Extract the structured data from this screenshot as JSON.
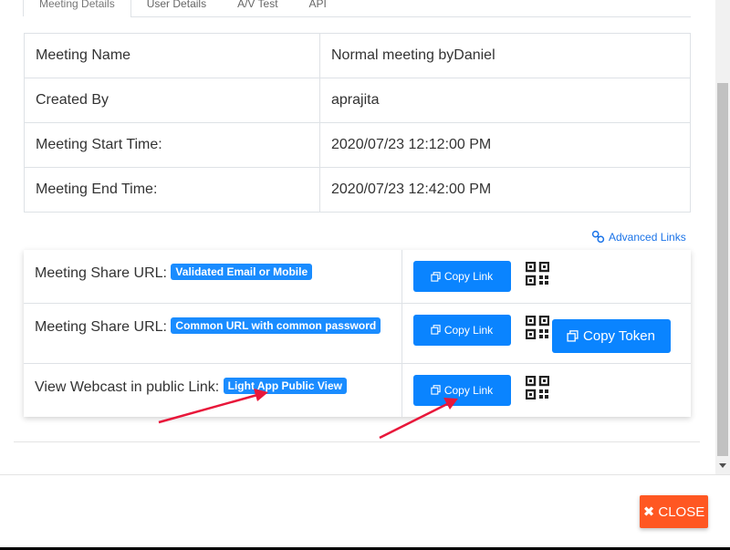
{
  "tabs": [
    {
      "label": "Meeting Details",
      "active": true
    },
    {
      "label": "User Details",
      "active": false
    },
    {
      "label": "A/V Test",
      "active": false
    },
    {
      "label": "API",
      "active": false
    }
  ],
  "details": {
    "rows": [
      {
        "key": "Meeting Name",
        "value": "Normal meeting byDaniel"
      },
      {
        "key": "Created By",
        "value": "aprajita"
      },
      {
        "key": "Meeting Start Time:",
        "value": "2020/07/23 12:12:00 PM"
      },
      {
        "key": "Meeting End Time:",
        "value": "2020/07/23 12:42:00 PM"
      }
    ]
  },
  "advanced_links": {
    "label": "Advanced Links",
    "icon": "link-icon"
  },
  "share": {
    "rows": [
      {
        "label": "Meeting Share URL:",
        "badge": "Validated Email or Mobile",
        "copy_label": "Copy Link"
      },
      {
        "label": "Meeting Share URL:",
        "badge": "Common URL with common password",
        "copy_label": "Copy Link",
        "token_label": "Copy Token"
      },
      {
        "label": "View Webcast in public Link:",
        "badge": "Light App Public View",
        "copy_label": "Copy Link"
      }
    ]
  },
  "close_button": {
    "label": "CLOSE",
    "icon": "times-icon"
  },
  "colors": {
    "primary": "#0a84ff",
    "badge": "#1a8cff",
    "close": "#ff5722",
    "link": "#1a73e8",
    "annotation_arrow": "#e8173a"
  }
}
